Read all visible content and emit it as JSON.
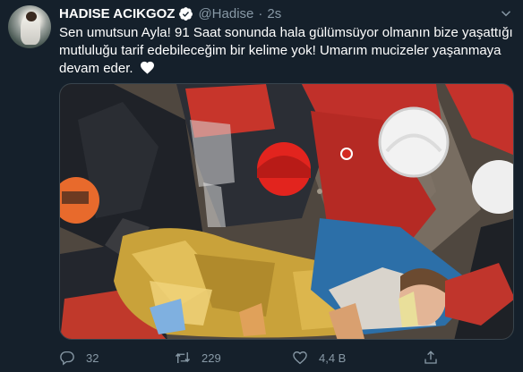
{
  "tweet": {
    "author_name": "HADISE ACIKGOZ",
    "handle": "@Hadise",
    "separator": "·",
    "time": "2s",
    "text": "Sen umutsun Ayla! 91 Saat sonunda hala gülümsüyor olmanın bize yaşattığı mutluluğu tarif edebileceğim bir kelime yok! Umarım mucizeler yaşanmaya devam eder.",
    "icons": {
      "verified": "verified-badge-icon",
      "heart": "white-heart-emoji",
      "caret": "chevron-down-icon"
    }
  },
  "actions": {
    "reply_count": "32",
    "retweet_count": "229",
    "like_count": "4,4 B"
  },
  "colors": {
    "background": "#15202b",
    "secondary_text": "#8899a6",
    "verified_badge": "#1da1f2",
    "border": "#38444d"
  }
}
